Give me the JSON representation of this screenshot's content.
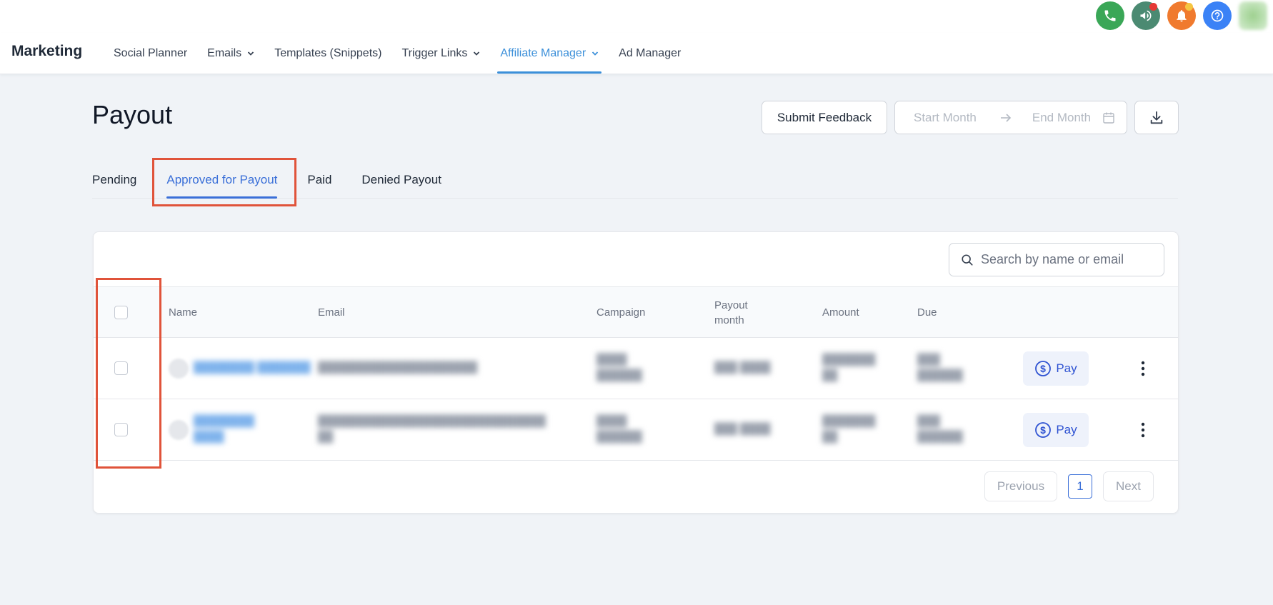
{
  "topbar": {
    "icons": [
      {
        "name": "phone-icon",
        "color": "#3aa757"
      },
      {
        "name": "megaphone-icon",
        "color": "#4b8a72",
        "badge": "#e53935"
      },
      {
        "name": "bell-icon",
        "color": "#f07a2e",
        "badge": "#f5c542"
      },
      {
        "name": "help-icon",
        "color": "#3b82f6"
      }
    ]
  },
  "nav": {
    "brand": "Marketing",
    "items": [
      {
        "label": "Social Planner",
        "dropdown": false
      },
      {
        "label": "Emails",
        "dropdown": true
      },
      {
        "label": "Templates (Snippets)",
        "dropdown": false
      },
      {
        "label": "Trigger Links",
        "dropdown": true
      },
      {
        "label": "Affiliate Manager",
        "dropdown": true,
        "active": true
      },
      {
        "label": "Ad Manager",
        "dropdown": false
      }
    ]
  },
  "header": {
    "title": "Payout",
    "feedback_label": "Submit Feedback",
    "start_placeholder": "Start Month",
    "end_placeholder": "End Month"
  },
  "tabs": [
    {
      "label": "Pending"
    },
    {
      "label": "Approved for Payout",
      "active": true
    },
    {
      "label": "Paid"
    },
    {
      "label": "Denied Payout"
    }
  ],
  "table": {
    "search_placeholder": "Search by name or email",
    "columns": {
      "name": "Name",
      "email": "Email",
      "campaign": "Campaign",
      "payout_month_1": "Payout",
      "payout_month_2": "month",
      "amount": "Amount",
      "due": "Due"
    },
    "pay_label": "Pay"
  },
  "pagination": {
    "previous": "Previous",
    "page": "1",
    "next": "Next"
  },
  "colors": {
    "accent": "#3a6fd8",
    "nav_active": "#3b8fd9",
    "highlight": "#e0533a"
  }
}
